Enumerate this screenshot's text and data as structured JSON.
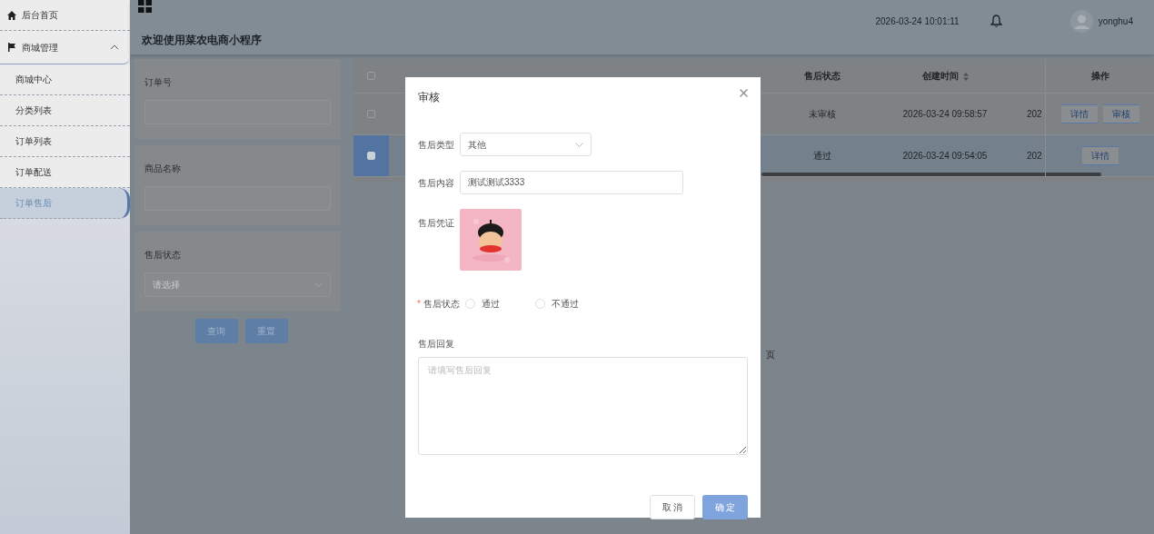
{
  "sidebar": {
    "items": [
      {
        "label": "后台首页",
        "kind": "home"
      },
      {
        "label": "商城管理",
        "kind": "group",
        "expanded": true,
        "children": [
          {
            "label": "商城中心",
            "selected": false
          },
          {
            "label": "分类列表",
            "selected": false
          },
          {
            "label": "订单列表",
            "selected": false
          },
          {
            "label": "订单配送",
            "selected": false
          },
          {
            "label": "订单售后",
            "selected": true
          }
        ]
      }
    ]
  },
  "header": {
    "title": "欢迎使用菜农电商小程序",
    "datetime": "2026-03-24 10:01:11",
    "username": "yonghu4"
  },
  "search": {
    "fields": [
      {
        "label": "订单号",
        "kind": "text"
      },
      {
        "label": "商品名称",
        "kind": "text"
      },
      {
        "label": "售后状态",
        "kind": "select",
        "placeholder": "请选择"
      }
    ],
    "buttons": [
      "查询",
      "重置"
    ]
  },
  "table": {
    "all_selected": false,
    "columns": [
      {
        "label": "售后状态",
        "sortable": false
      },
      {
        "label": "创建时间",
        "sortable": true
      },
      {
        "label": "操作",
        "sortable": false
      }
    ],
    "rows": [
      {
        "selected": false,
        "cells": [
          "未审核",
          "2026-03-24 09:58:57",
          "202"
        ],
        "actions": [
          "详情",
          "审核"
        ]
      },
      {
        "selected": true,
        "cells": [
          "通过",
          "2026-03-24 09:54:05",
          "202"
        ],
        "actions": [
          "详情"
        ]
      }
    ]
  },
  "pagination": {
    "text": "页"
  },
  "dialog": {
    "title": "审核",
    "type": {
      "label": "售后类型",
      "value": "其他"
    },
    "content": {
      "label": "售后内容",
      "value": "测试测试3333"
    },
    "proof": {
      "label": "售后凭证",
      "kind": "picture"
    },
    "status": {
      "label": "售后状态",
      "required_mark": "*",
      "options": [
        {
          "label": "通过",
          "selected": false
        },
        {
          "label": "不通过",
          "selected": false
        }
      ]
    },
    "reply": {
      "label": "售后回复",
      "placeholder": "请填写售后回复"
    },
    "buttons": [
      {
        "label": "取 消",
        "kind": "cancel"
      },
      {
        "label": "确 定",
        "kind": "confirm"
      }
    ]
  }
}
